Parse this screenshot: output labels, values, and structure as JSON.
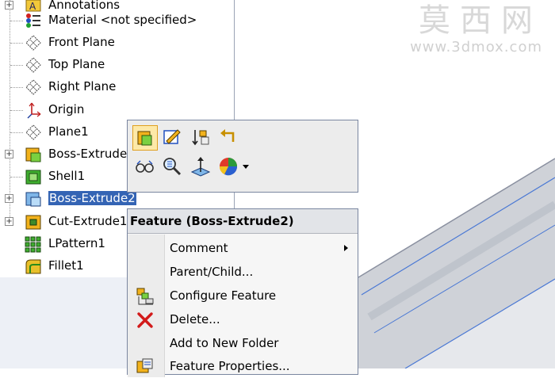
{
  "tree": {
    "items": [
      {
        "label": "Annotations",
        "icon": "annotations-icon",
        "expandable": true
      },
      {
        "label": "Material <not specified>",
        "icon": "material-icon",
        "expandable": false
      },
      {
        "label": "Front Plane",
        "icon": "plane-icon",
        "expandable": false
      },
      {
        "label": "Top Plane",
        "icon": "plane-icon",
        "expandable": false
      },
      {
        "label": "Right Plane",
        "icon": "plane-icon",
        "expandable": false
      },
      {
        "label": "Origin",
        "icon": "origin-icon",
        "expandable": false
      },
      {
        "label": "Plane1",
        "icon": "plane-icon",
        "expandable": false
      },
      {
        "label": "Boss-Extrude1",
        "icon": "boss-extrude-icon",
        "expandable": true
      },
      {
        "label": "Shell1",
        "icon": "shell-icon",
        "expandable": false
      },
      {
        "label": "Boss-Extrude2",
        "icon": "boss-extrude-icon",
        "expandable": true,
        "selected": true
      },
      {
        "label": "Cut-Extrude1",
        "icon": "cut-extrude-icon",
        "expandable": true
      },
      {
        "label": "LPattern1",
        "icon": "linear-pattern-icon",
        "expandable": false
      },
      {
        "label": "Fillet1",
        "icon": "fillet-icon",
        "expandable": false
      }
    ]
  },
  "watermark": {
    "text_cn": "莫西网",
    "url": "www.3dmox.com"
  },
  "toolbar": {
    "buttons": [
      {
        "icon": "edit-feature-icon"
      },
      {
        "icon": "edit-sketch-icon"
      },
      {
        "icon": "rollback-icon"
      },
      {
        "icon": "undo-icon"
      },
      {
        "icon": "hide-show-icon"
      },
      {
        "icon": "zoom-to-selection-icon"
      },
      {
        "icon": "normal-to-icon"
      },
      {
        "icon": "appearance-icon"
      }
    ]
  },
  "menu": {
    "title": "Feature (Boss-Extrude2)",
    "items": [
      {
        "label": "Comment",
        "submenu": true
      },
      {
        "label": "Parent/Child...",
        "submenu": false
      },
      {
        "label": "Configure Feature",
        "submenu": false,
        "icon": "configure-feature-icon"
      },
      {
        "label": "Delete...",
        "submenu": false,
        "icon": "delete-icon"
      },
      {
        "label": "Add to New Folder",
        "submenu": false
      },
      {
        "label": "Feature Properties...",
        "submenu": false,
        "icon": "feature-properties-icon"
      }
    ]
  },
  "colors": {
    "selection": "#3464b4",
    "menu_border": "#7a86a0",
    "model_body": "#c9ccd2",
    "model_edge": "#4a78d4"
  }
}
